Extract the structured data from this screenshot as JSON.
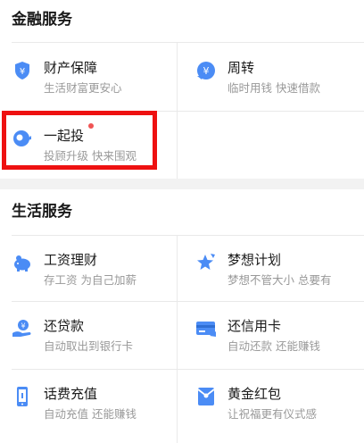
{
  "finance": {
    "title": "金融服务",
    "items": [
      {
        "title": "财产保障",
        "subtitle": "生活财富更安心",
        "icon": "shield-icon"
      },
      {
        "title": "周转",
        "subtitle": "临时用钱 快速借款",
        "icon": "yuan-coin-icon"
      },
      {
        "title": "一起投",
        "subtitle": "投顾升级 快来围观",
        "icon": "invest-icon"
      }
    ]
  },
  "life": {
    "title": "生活服务",
    "items": [
      {
        "title": "工资理财",
        "subtitle": "存工资 为自己加薪",
        "icon": "piggy-bank-icon"
      },
      {
        "title": "梦想计划",
        "subtitle": "梦想不管大小 总要有",
        "icon": "star-pen-icon"
      },
      {
        "title": "还贷款",
        "subtitle": "自动取出到银行卡",
        "icon": "loan-hand-icon"
      },
      {
        "title": "还信用卡",
        "subtitle": "自动还款 还能赚钱",
        "icon": "credit-card-icon"
      },
      {
        "title": "话费充值",
        "subtitle": "自动充值 还能赚钱",
        "icon": "phone-icon"
      },
      {
        "title": "黄金红包",
        "subtitle": "让祝福更有仪式感",
        "icon": "red-envelope-icon"
      }
    ]
  },
  "colors": {
    "icon": "#4b8cf5",
    "highlight": "#ee1111",
    "badge": "#f05454"
  }
}
